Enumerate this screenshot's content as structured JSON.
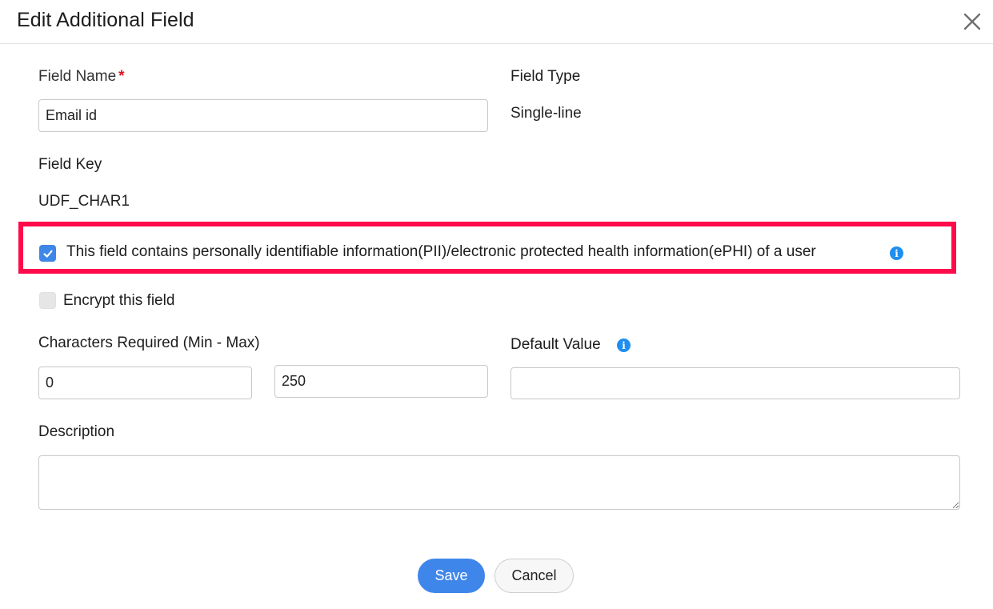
{
  "dialog": {
    "title": "Edit Additional Field",
    "close_icon": "close-icon"
  },
  "form": {
    "field_name": {
      "label": "Field Name",
      "required_marker": "*",
      "value": "Email id"
    },
    "field_type": {
      "label": "Field Type",
      "value": "Single-line"
    },
    "field_key": {
      "label": "Field Key",
      "value": "UDF_CHAR1"
    },
    "pii_checkbox": {
      "label": "This field contains personally identifiable information(PII)/electronic protected health information(ePHI) of a user",
      "checked": true,
      "info_icon": "info-icon"
    },
    "encrypt_checkbox": {
      "label": "Encrypt this field",
      "checked": false
    },
    "characters_required": {
      "label": "Characters Required (Min - Max)",
      "min_value": "0",
      "max_value": "250"
    },
    "default_value": {
      "label": "Default Value",
      "value": "",
      "info_icon": "info-icon"
    },
    "description": {
      "label": "Description",
      "value": ""
    }
  },
  "highlight": {
    "color": "#ff0a4b"
  },
  "footer": {
    "save_label": "Save",
    "cancel_label": "Cancel"
  },
  "colors": {
    "primary": "#3f86ea",
    "info": "#1e8ef0",
    "required": "#e0151f"
  }
}
